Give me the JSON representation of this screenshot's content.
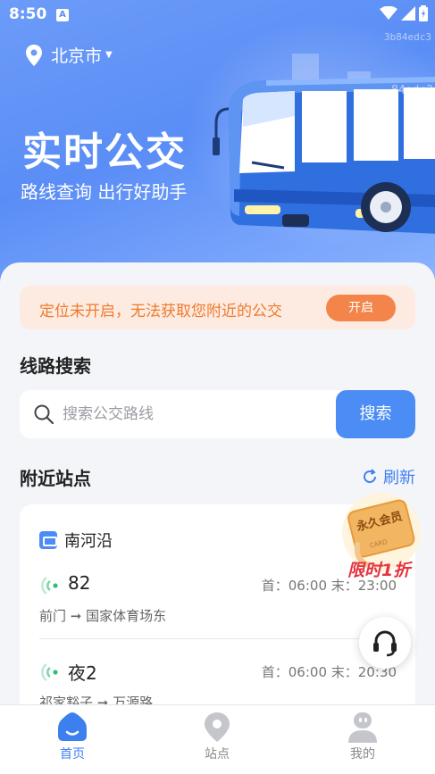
{
  "status_bar": {
    "time": "8:50",
    "notification_icon": "A"
  },
  "watermarks": [
    "3b84edc3",
    "84edc3"
  ],
  "header": {
    "city": "北京市",
    "title": "实时公交",
    "subtitle": "路线查询 出行好助手"
  },
  "notice": {
    "text": "定位未开启，无法获取您附近的公交",
    "button": "开启"
  },
  "line_search": {
    "title": "线路搜索",
    "placeholder": "搜索公交路线",
    "button": "搜索"
  },
  "nearby": {
    "title": "附近站点",
    "refresh": "刷新",
    "stop_name": "南河沿",
    "routes": [
      {
        "number": "82",
        "times": "首：06:00  末：23:00",
        "direction": "前门 ➞ 国家体育场东"
      },
      {
        "number": "夜2",
        "times": "首：06:00  末：20:30",
        "direction": "祁家豁子 ➞ 万源路"
      }
    ]
  },
  "promo": {
    "badge": "永久会员",
    "card_text": "CARD",
    "label": "限时1折"
  },
  "tabs": [
    {
      "label": "首页",
      "active": true
    },
    {
      "label": "站点",
      "active": false
    },
    {
      "label": "我的",
      "active": false
    }
  ],
  "colors": {
    "primary": "#4c8cf5",
    "warning": "#ee7a2d",
    "promo_red": "#e4353f"
  }
}
